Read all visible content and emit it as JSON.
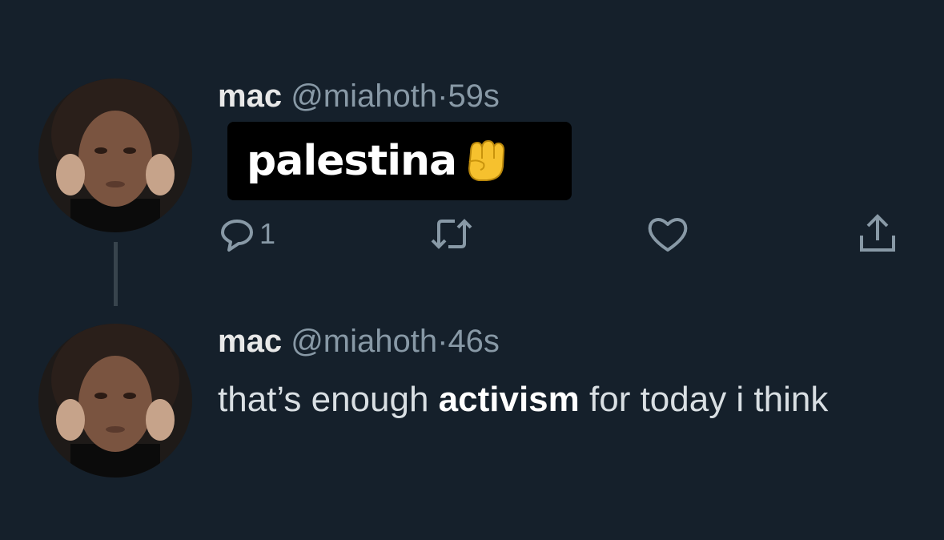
{
  "tweets": [
    {
      "name": "mac",
      "handle": "@miahoth",
      "separator": "·",
      "time": "59s",
      "text": "palestina",
      "emoji_icon": "raised-fist-icon",
      "reply_count": "1"
    },
    {
      "name": "mac",
      "handle": "@miahoth",
      "separator": "·",
      "time": "46s",
      "text_before": "that’s enough",
      "text_bold": "activism",
      "text_after": "for today i think"
    }
  ],
  "colors": {
    "background": "#15202b",
    "secondary_text": "#8899a6",
    "highlight_box": "#000000"
  }
}
